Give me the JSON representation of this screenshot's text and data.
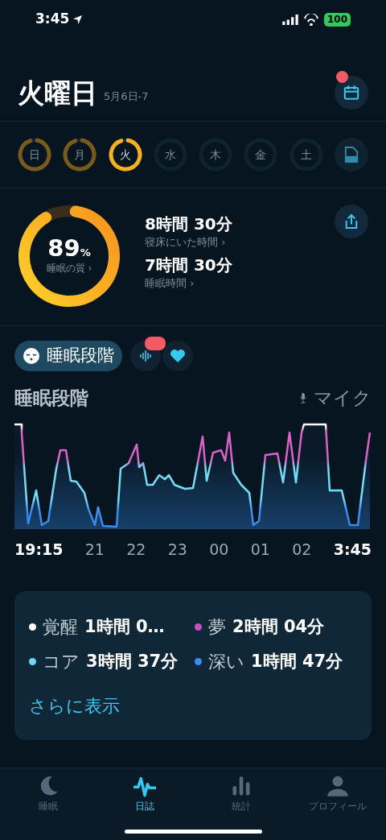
{
  "status_bar": {
    "time": "3:45",
    "battery": "100"
  },
  "header": {
    "title": "火曜日",
    "date_range": "5月6日-7",
    "calendar_badge": true
  },
  "days": [
    {
      "label": "日",
      "selected": false,
      "has_data": true
    },
    {
      "label": "月",
      "selected": false,
      "has_data": true
    },
    {
      "label": "火",
      "selected": true,
      "has_data": true
    },
    {
      "label": "水",
      "selected": false,
      "has_data": false
    },
    {
      "label": "木",
      "selected": false,
      "has_data": false
    },
    {
      "label": "金",
      "selected": false,
      "has_data": false
    },
    {
      "label": "土",
      "selected": false,
      "has_data": false
    }
  ],
  "summary": {
    "score": "89",
    "score_unit": "%",
    "score_label": "睡眠の質 ›",
    "level": 0.89,
    "stats": [
      {
        "value": "8時間 30分",
        "label": "寝床にいた時間 ›"
      },
      {
        "value": "7時間 30分",
        "label": "睡眠時間 ›"
      }
    ]
  },
  "view_chips": [
    {
      "kind": "stages",
      "label": "睡眠段階",
      "selected": true
    },
    {
      "kind": "sound",
      "selected": false,
      "badge": true
    },
    {
      "kind": "heart",
      "selected": false
    }
  ],
  "chart": {
    "title": "睡眠段階",
    "source": "マイク",
    "start_time": "19:15",
    "hour_labels": [
      "21",
      "22",
      "23",
      "00",
      "01",
      "02"
    ],
    "end_time": "3:45"
  },
  "stages": [
    {
      "name": "覚醒",
      "duration": "1時間 0…",
      "color": "#ffffff"
    },
    {
      "name": "夢",
      "duration": "2時間 04分",
      "color": "#c84fc0"
    },
    {
      "name": "コア",
      "duration": "3時間 37分",
      "color": "#6fd8f4"
    },
    {
      "name": "深い",
      "duration": "1時間 47分",
      "color": "#3a8cf0"
    }
  ],
  "more_link": "さらに表示",
  "tab_bar": [
    {
      "kind": "moon",
      "label": "睡眠",
      "selected": false
    },
    {
      "kind": "wave",
      "label": "日誌",
      "selected": true
    },
    {
      "kind": "bars",
      "label": "統計",
      "selected": false
    },
    {
      "kind": "person",
      "label": "プロフィール",
      "selected": false
    }
  ]
}
